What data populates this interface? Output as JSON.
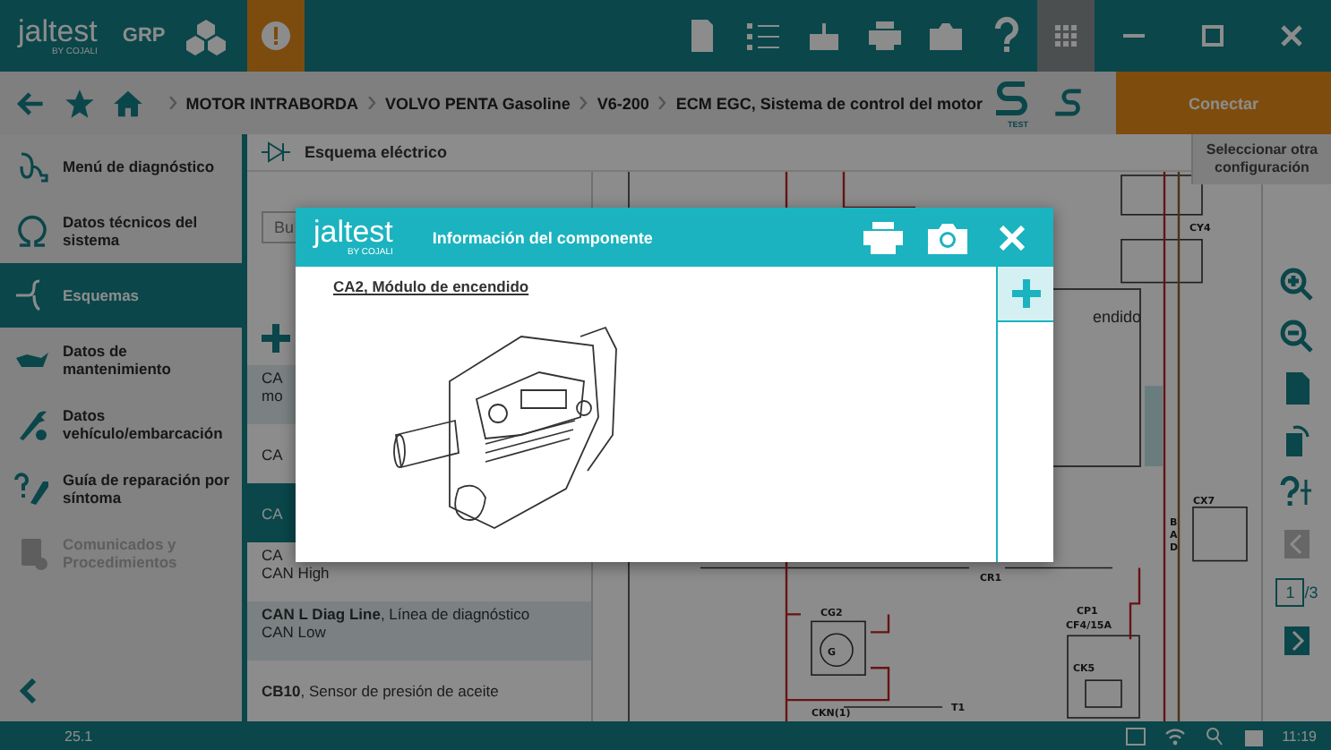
{
  "top_bar": {
    "logo": "jaltest",
    "logo_sub": "BY COJALI",
    "mode": "GRP"
  },
  "breadcrumb": [
    "MOTOR INTRABORDA",
    "VOLVO PENTA Gasoline",
    "V6-200",
    "ECM EGC, Sistema de control del motor"
  ],
  "test_label": "TEST",
  "connect_button": "Conectar",
  "select_config_button": "Seleccionar otra configuración",
  "sidebar": {
    "items": [
      {
        "kind": "diagnosis",
        "label": "Menú de diagnóstico",
        "selected": false,
        "disabled": false
      },
      {
        "kind": "technical",
        "label": "Datos técnicos del sistema",
        "selected": false,
        "disabled": false
      },
      {
        "kind": "schemes",
        "label": "Esquemas",
        "selected": true,
        "disabled": false
      },
      {
        "kind": "maintenance",
        "label": "Datos de mantenimiento",
        "selected": false,
        "disabled": false
      },
      {
        "kind": "vehicle",
        "label": "Datos vehículo/embarcación",
        "selected": false,
        "disabled": false
      },
      {
        "kind": "repair",
        "label": "Guía de reparación por síntoma",
        "selected": false,
        "disabled": false
      },
      {
        "kind": "bulletins",
        "label": "Comunicados y Procedimientos",
        "selected": false,
        "disabled": true
      }
    ]
  },
  "panel": {
    "title": "Esquema eléctrico",
    "search": {
      "placeholder": "Bu"
    },
    "components": [
      {
        "title": "CA",
        "subtitle": "mo",
        "selected": false
      },
      {
        "title": "CA",
        "selected": false
      },
      {
        "title": "CA",
        "selected": true
      },
      {
        "title": "CA",
        "subtitle": "CAN High",
        "selected": false
      },
      {
        "title": "**CAN L Diag Line**, Línea de diagnóstico",
        "subtitle": "CAN Low",
        "selected": false
      },
      {
        "title": "**CB10**, Sensor de presión de aceite",
        "selected": false
      }
    ]
  },
  "schematic": {
    "labels": [
      "CY4",
      "CX7",
      "B",
      "A",
      "D",
      "CP1",
      "CF4/15A",
      "CK5",
      "CR1",
      "CG2",
      "G",
      "CKN(1)",
      "T1"
    ],
    "popup_text": "endido"
  },
  "pager": {
    "page": "1",
    "total": "/3"
  },
  "status_bar": {
    "version": "25.1",
    "time": "11:19"
  },
  "modal": {
    "logo": "jaltest",
    "logo_sub": "BY COJALI",
    "title": "Información del componente",
    "component": "CA2, Módulo de encendido"
  }
}
